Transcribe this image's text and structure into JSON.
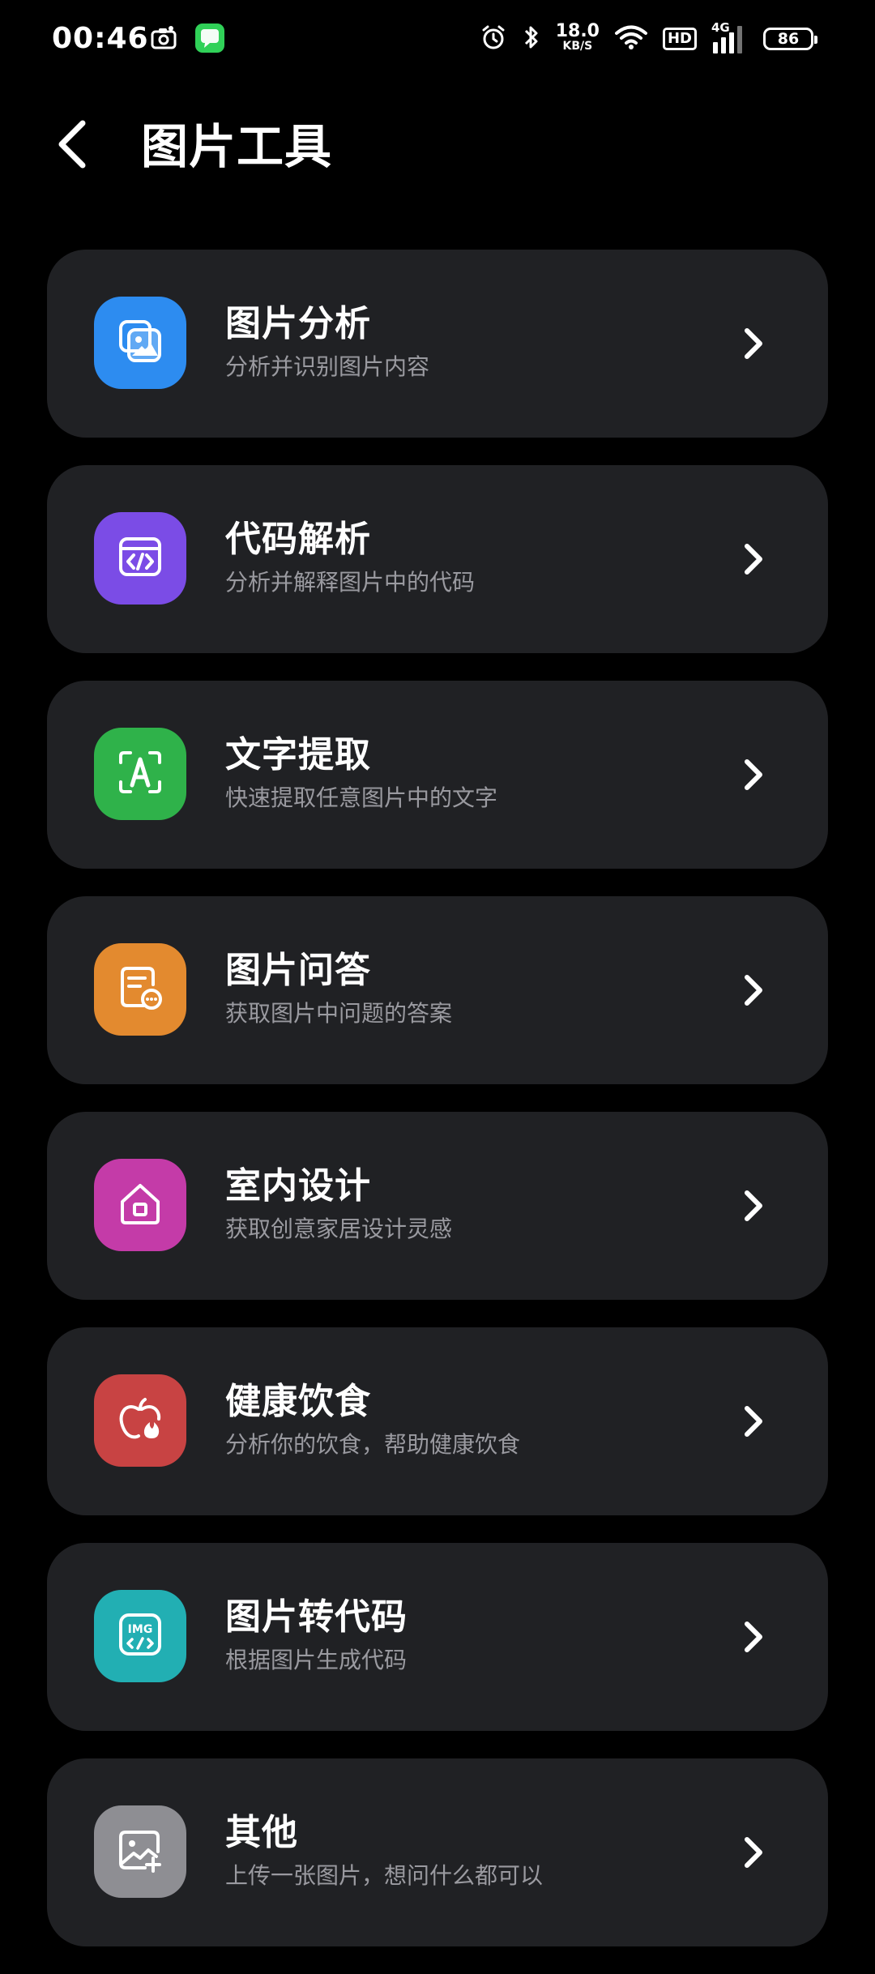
{
  "status_bar": {
    "time": "00:46",
    "net_speed_value": "18.0",
    "net_speed_unit": "KB/S",
    "hd_label": "HD",
    "signal_label": "4G",
    "battery_level": "86",
    "icons": [
      "camera-icon",
      "messages-app-icon",
      "alarm-icon",
      "bluetooth-icon",
      "wifi-icon",
      "hd-icon",
      "cellular-signal-icon",
      "battery-icon"
    ]
  },
  "header": {
    "title": "图片工具",
    "back_icon": "chevron-left-icon"
  },
  "tools": [
    {
      "name": "图片分析",
      "desc": "分析并识别图片内容",
      "color": "#2D8CF0",
      "icon": "image-gallery-icon"
    },
    {
      "name": "代码解析",
      "desc": "分析并解释图片中的代码",
      "color": "#7B4CE6",
      "icon": "code-window-icon"
    },
    {
      "name": "文字提取",
      "desc": "快速提取任意图片中的文字",
      "color": "#2FB24A",
      "icon": "text-scan-icon"
    },
    {
      "name": "图片问答",
      "desc": "获取图片中问题的答案",
      "color": "#E38A2F",
      "icon": "document-chat-icon"
    },
    {
      "name": "室内设计",
      "desc": "获取创意家居设计灵感",
      "color": "#C43BA8",
      "icon": "house-icon"
    },
    {
      "name": "健康饮食",
      "desc": "分析你的饮食，帮助健康饮食",
      "color": "#C84343",
      "icon": "apple-flame-icon"
    },
    {
      "name": "图片转代码",
      "desc": "根据图片生成代码",
      "color": "#22AFB3",
      "icon": "img-code-icon"
    },
    {
      "name": "其他",
      "desc": "上传一张图片，想问什么都可以",
      "color": "#8E8E93",
      "icon": "image-add-icon"
    }
  ]
}
